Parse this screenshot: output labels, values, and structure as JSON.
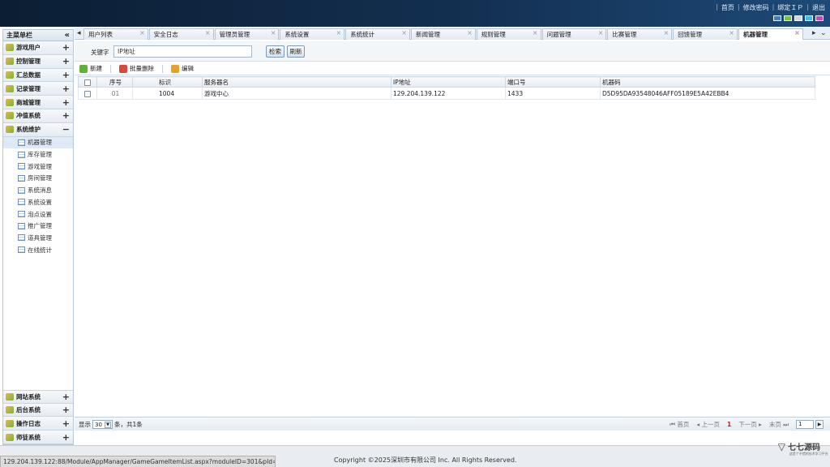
{
  "header": {
    "links": [
      "首页",
      "修改密码",
      "绑定ＩＰ",
      "退出"
    ],
    "swatches": [
      "#4a78c2",
      "#7dbf3f",
      "#d6d6d6",
      "#48b8e8",
      "#c04ab8"
    ]
  },
  "sidebar": {
    "title": "主菜单栏",
    "collapse_icon": "double-chevron-left-icon",
    "groups_top": [
      {
        "label": "游戏用户",
        "toggle": "+"
      },
      {
        "label": "控制管理",
        "toggle": "+"
      },
      {
        "label": "汇总数据",
        "toggle": "+"
      },
      {
        "label": "记录管理",
        "toggle": "+"
      },
      {
        "label": "商城管理",
        "toggle": "+"
      },
      {
        "label": "冲值系统",
        "toggle": "+"
      },
      {
        "label": "系统维护",
        "toggle": "−"
      }
    ],
    "items": [
      "机器管理",
      "库存管理",
      "游戏管理",
      "房间管理",
      "系统消息",
      "系统设置",
      "泡点设置",
      "推广管理",
      "道具管理",
      "在线统计"
    ],
    "active_item": 0,
    "groups_bottom": [
      {
        "label": "网站系统",
        "toggle": "+"
      },
      {
        "label": "后台系统",
        "toggle": "+"
      },
      {
        "label": "操作日志",
        "toggle": "+"
      },
      {
        "label": "师徒系统",
        "toggle": "+"
      }
    ]
  },
  "tabs": {
    "items": [
      "用户列表",
      "安全日志",
      "管理员管理",
      "系统设置",
      "系统统计",
      "新闻管理",
      "规则管理",
      "问题管理",
      "比赛管理",
      "回馈管理",
      "机器管理"
    ],
    "active": 10,
    "left_nav": "◂",
    "right_nav": "▸",
    "more": "⌄"
  },
  "search": {
    "keyword_label": "关键字",
    "value": "IP地址",
    "search_button": "检索",
    "refresh_button": "刷新"
  },
  "toolbar": {
    "new_label": "新建",
    "batch_delete_label": "批量删除",
    "edit_label": "编辑"
  },
  "table": {
    "columns": [
      "序号",
      "标识",
      "服务器名",
      "IP地址",
      "端口号",
      "机器码"
    ],
    "rows": [
      {
        "seq": "01",
        "id": "1004",
        "name": "游戏中心",
        "ip": "129.204.139.122",
        "port": "1433",
        "machine_code": "D5D95DA93548046AFF05189E5A42EBB4"
      }
    ]
  },
  "pager": {
    "show_label": "显示",
    "page_size": "30",
    "summary": "条，共1条",
    "first": "首页",
    "prev": "上一页",
    "current": "1",
    "next": "下一页",
    "last": "末页",
    "goto_value": "1",
    "go_icon": "▶"
  },
  "footer": {
    "status_url": "129.204.139.122:88/Module/AppManager/GameGameItemList.aspx?moduleID=301&pId=3&...",
    "copyright": "Copyright ©2025深圳市有限公司 Inc. All Rights Reserved.",
    "logo_text": "七七源码",
    "logo_sub": "这是个不错的技术学习平台"
  }
}
